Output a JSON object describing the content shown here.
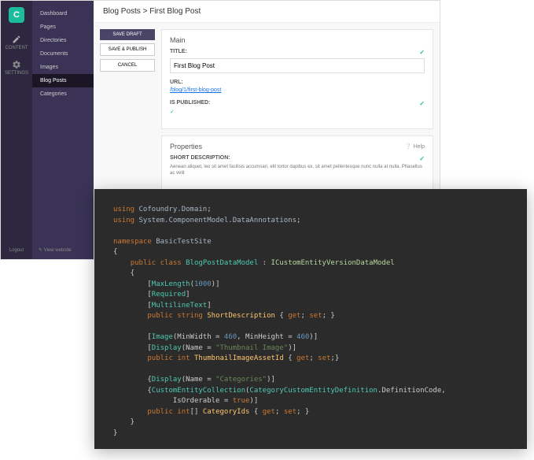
{
  "rail": {
    "content_label": "CONTENT",
    "settings_label": "SETTINGS",
    "logout_label": "Logout"
  },
  "sidebar": {
    "items": [
      {
        "label": "Dashboard"
      },
      {
        "label": "Pages"
      },
      {
        "label": "Directories"
      },
      {
        "label": "Documents"
      },
      {
        "label": "Images"
      },
      {
        "label": "Blog Posts"
      },
      {
        "label": "Categories"
      }
    ],
    "view_website": "View website"
  },
  "breadcrumb": "Blog Posts > First Blog Post",
  "actions": {
    "save_draft": "SAVE DRAFT",
    "save_publish": "SAVE & PUBLISH",
    "cancel": "CANCEL"
  },
  "panels": {
    "main": {
      "title": "Main",
      "fields": {
        "title_label": "TITLE:",
        "title_value": "First Blog Post",
        "url_label": "URL:",
        "url_value": "/blog/1/first-blog-post",
        "published_label": "IS PUBLISHED:"
      }
    },
    "properties": {
      "title": "Properties",
      "help": "Help",
      "short_desc_label": "SHORT DESCRIPTION:",
      "short_desc_value": "Aenean aliquet, leo sit amet facilisis accumsan, elit tortor dapibus ex, sit amet pellentesque nunc nulla at nulla. Phasellus ac velit"
    }
  },
  "code": {
    "lines": [
      {
        "type": "using",
        "ns": "Cofoundry.Domain"
      },
      {
        "type": "using",
        "ns": "System.ComponentModel.DataAnnotations"
      },
      {
        "type": "blank"
      },
      {
        "type": "namespace",
        "name": "BasicTestSite"
      },
      {
        "type": "open"
      },
      {
        "type": "class",
        "mod": "public class",
        "name": "BlogPostDataModel",
        "iface": "ICustomEntityVersionDataModel"
      },
      {
        "type": "open2"
      },
      {
        "type": "attr",
        "text": "MaxLength(1000)"
      },
      {
        "type": "attr",
        "text": "Required"
      },
      {
        "type": "attr",
        "text": "MultilineText"
      },
      {
        "type": "prop",
        "mod": "public",
        "ptype": "string",
        "name": "ShortDescription"
      },
      {
        "type": "blank"
      },
      {
        "type": "attr",
        "text": "Image(MinWidth = 460, MinHeight = 460)"
      },
      {
        "type": "attr",
        "text": "Display(Name = \"Thumbnail Image\")"
      },
      {
        "type": "prop",
        "mod": "public",
        "ptype": "int",
        "name": "ThumbnailImageAssetId"
      },
      {
        "type": "blank"
      },
      {
        "type": "attr",
        "text": "Display(Name = \"Categories\")"
      },
      {
        "type": "attr",
        "text": "CustomEntityCollection(CategoryCustomEntityDefinition.DefinitionCode, IsOrderable = true)"
      },
      {
        "type": "prop",
        "mod": "public",
        "ptype": "int[]",
        "name": "CategoryIds"
      },
      {
        "type": "close2"
      },
      {
        "type": "close"
      }
    ]
  }
}
